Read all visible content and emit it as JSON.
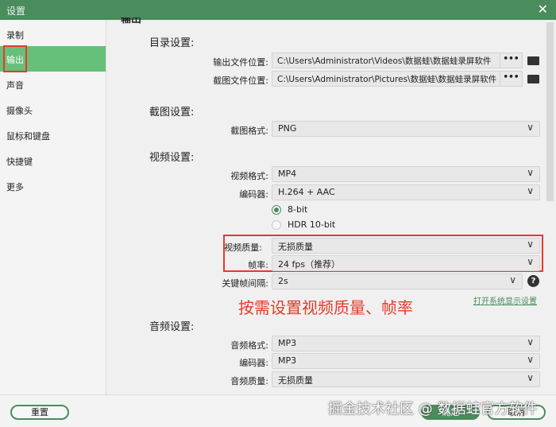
{
  "window": {
    "title": "设置",
    "close": "✕"
  },
  "sidebar": {
    "items": [
      {
        "label": "录制"
      },
      {
        "label": "输出"
      },
      {
        "label": "声音"
      },
      {
        "label": "摄像头"
      },
      {
        "label": "鼠标和键盘"
      },
      {
        "label": "快捷键"
      },
      {
        "label": "更多"
      }
    ]
  },
  "main": {
    "page_title": "输出",
    "directory": {
      "title": "目录设置:",
      "output_label": "输出文件位置:",
      "output_path": "C:\\Users\\Administrator\\Videos\\数据蛙\\数据蛙录屏软件",
      "screenshot_label": "截图文件位置:",
      "screenshot_path": "C:\\Users\\Administrator\\Pictures\\数据蛙\\数据蛙录屏软件",
      "browse": "•••"
    },
    "screenshot": {
      "title": "截图设置:",
      "format_label": "截图格式:",
      "format": "PNG"
    },
    "video": {
      "title": "视频设置:",
      "format_label": "视频格式:",
      "format": "MP4",
      "encoder_label": "编码器:",
      "encoder": "H.264 + AAC",
      "bit_8": "8-bit",
      "bit_hdr": "HDR 10-bit",
      "quality_label": "视频质量:",
      "quality": "无损质量",
      "fps_label": "帧率:",
      "fps": "24 fps（推荐）",
      "keyframe_label": "关键帧间隔:",
      "keyframe": "2s",
      "help": "?",
      "display_link": "打开系统显示设置"
    },
    "annotation": "按需设置视频质量、帧率",
    "audio": {
      "title": "音频设置:",
      "format_label": "音频格式:",
      "format": "MP3",
      "encoder_label": "编码器:",
      "encoder": "MP3",
      "quality_label": "音频质量:",
      "quality": "无损质量"
    }
  },
  "footer": {
    "reset": "重置",
    "ok": "确定",
    "cancel": "取消",
    "watermark": "掘金技术社区 @ 数据蛙官方软件"
  },
  "colors": {
    "accent": "#4a8c5c",
    "selected": "#66c07a",
    "highlight": "#e53a2a"
  }
}
